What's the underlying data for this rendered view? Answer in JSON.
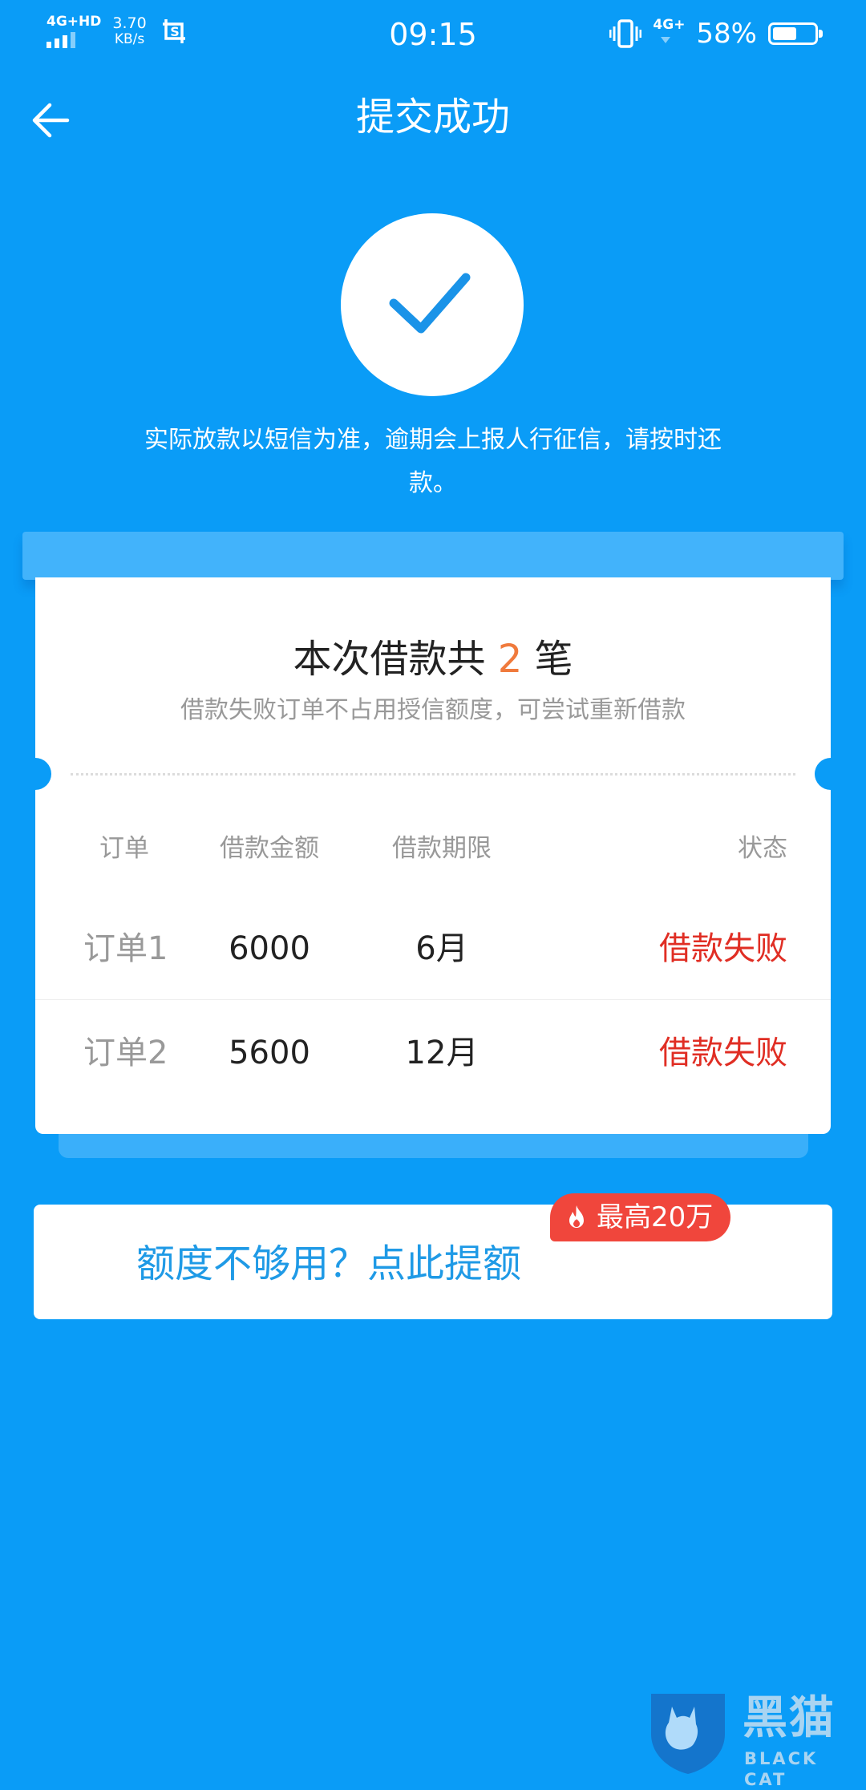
{
  "status_bar": {
    "network": "4G+HD",
    "speed_value": "3.70",
    "speed_unit": "KB/s",
    "time": "09:15",
    "network_right": "4G+",
    "battery_percent": "58%",
    "battery_level": 0.58,
    "icons": [
      "signal-icon",
      "screenshot-crop-icon",
      "vibrate-icon",
      "battery-icon"
    ]
  },
  "header": {
    "title": "提交成功",
    "back_icon": "back-arrow-icon"
  },
  "success": {
    "icon": "checkmark-icon",
    "notice": "实际放款以短信为准，逾期会上报人行征信，请按时还款。"
  },
  "ticket": {
    "title_prefix": "本次借款共",
    "count": "2",
    "title_suffix": "笔",
    "subtitle": "借款失败订单不占用授信额度，可尝试重新借款",
    "columns": [
      "订单",
      "借款金额",
      "借款期限",
      "状态"
    ],
    "rows": [
      {
        "order": "订单1",
        "amount": "6000",
        "term": "6月",
        "status": "借款失败"
      },
      {
        "order": "订单2",
        "amount": "5600",
        "term": "12月",
        "status": "借款失败"
      }
    ]
  },
  "quota": {
    "text": "额度不够用？点此提额",
    "badge": "最高20万",
    "badge_icon": "fire-icon"
  },
  "watermark": {
    "text": "黑猫",
    "sub": "BLACK CAT"
  },
  "colors": {
    "background": "#0a9cf7",
    "accent_orange": "#f07a3c",
    "fail_red": "#e02e24",
    "badge_red": "#f0463c",
    "link_blue": "#1f9ae6"
  }
}
